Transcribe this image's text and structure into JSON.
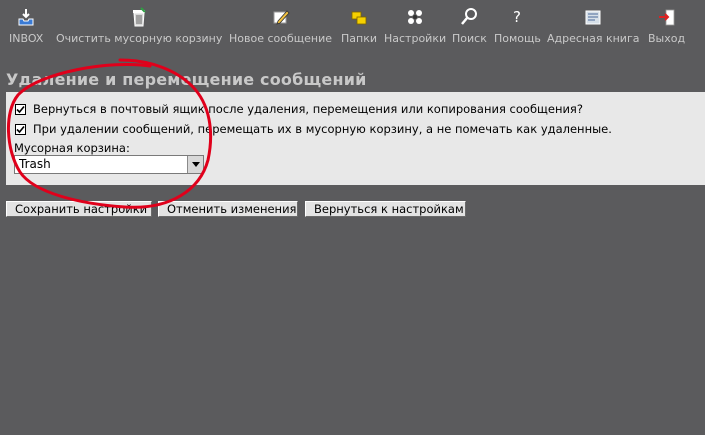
{
  "toolbar": {
    "items": [
      {
        "label": "INBOX",
        "icon": "inbox-icon"
      },
      {
        "label": "Очистить мусорную корзину",
        "icon": "trash-icon"
      },
      {
        "label": "Новое сообщение",
        "icon": "compose-icon"
      },
      {
        "label": "Папки",
        "icon": "folders-icon"
      },
      {
        "label": "Настройки",
        "icon": "settings-icon"
      },
      {
        "label": "Поиск",
        "icon": "search-icon"
      },
      {
        "label": "Помощь",
        "icon": "help-icon"
      },
      {
        "label": "Адресная книга",
        "icon": "address-book-icon"
      },
      {
        "label": "Выход",
        "icon": "logout-icon"
      }
    ]
  },
  "section": {
    "title": "Удаление и перемещение сообщений"
  },
  "options": {
    "return_after_delete": {
      "label": "Вернуться в почтовый ящик после удаления, перемещения или копирования сообщения?",
      "checked": true
    },
    "move_to_trash": {
      "label": "При удалении сообщений, перемещать их в мусорную корзину, а не помечать как удаленные.",
      "checked": true
    }
  },
  "trash_folder": {
    "label": "Мусорная корзина:",
    "value": "Trash"
  },
  "buttons": {
    "save": "Сохранить настройки",
    "cancel": "Отменить изменения",
    "back": "Вернуться к настройкам"
  },
  "colors": {
    "background": "#5b5b5d",
    "panel": "#e8e8e8",
    "annotation": "#e0001b"
  }
}
